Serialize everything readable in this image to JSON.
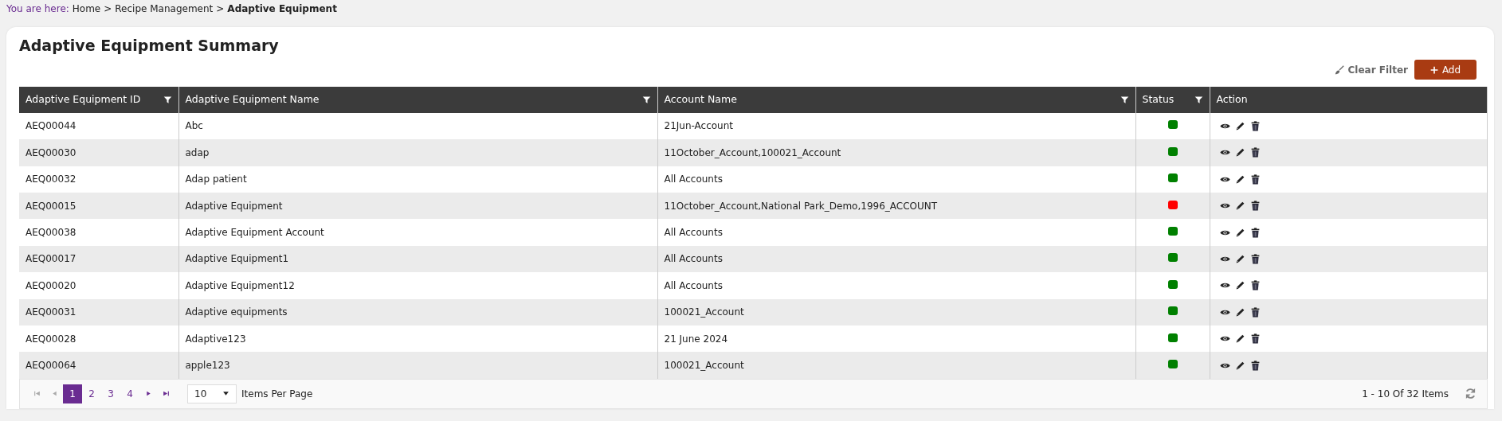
{
  "breadcrumb": {
    "prefix": "You are here:",
    "items": [
      {
        "label": "Home",
        "current": false
      },
      {
        "label": "Recipe Management",
        "current": false
      },
      {
        "label": "Adaptive Equipment",
        "current": true
      }
    ],
    "separator": ">"
  },
  "title": "Adaptive Equipment Summary",
  "toolbar": {
    "clear_filter": "Clear Filter",
    "add": "Add"
  },
  "table": {
    "columns": [
      {
        "label": "Adaptive Equipment ID",
        "filter": true
      },
      {
        "label": "Adaptive Equipment Name",
        "filter": true
      },
      {
        "label": "Account Name",
        "filter": true
      },
      {
        "label": "Status",
        "filter": true
      },
      {
        "label": "Action",
        "filter": false
      }
    ],
    "rows": [
      {
        "id": "AEQ00044",
        "name": "Abc",
        "account": "21Jun-Account",
        "color": "#008000"
      },
      {
        "id": "AEQ00030",
        "name": "adap",
        "account": "11October_Account,100021_Account",
        "color": "#008000"
      },
      {
        "id": "AEQ00032",
        "name": "Adap patient",
        "account": "All Accounts",
        "color": "#008000"
      },
      {
        "id": "AEQ00015",
        "name": "Adaptive Equipment",
        "account": "11October_Account,National Park_Demo,1996_ACCOUNT",
        "color": "#ff0000"
      },
      {
        "id": "AEQ00038",
        "name": "Adaptive Equipment Account",
        "account": "All Accounts",
        "color": "#008000"
      },
      {
        "id": "AEQ00017",
        "name": "Adaptive Equipment1",
        "account": "All Accounts",
        "color": "#008000"
      },
      {
        "id": "AEQ00020",
        "name": "Adaptive Equipment12",
        "account": "All Accounts",
        "color": "#008000"
      },
      {
        "id": "AEQ00031",
        "name": "Adaptive equipments",
        "account": "100021_Account",
        "color": "#008000"
      },
      {
        "id": "AEQ00028",
        "name": "Adaptive123",
        "account": "21 June 2024",
        "color": "#008000"
      },
      {
        "id": "AEQ00064",
        "name": "apple123",
        "account": "100021_Account",
        "color": "#008000"
      }
    ]
  },
  "pager": {
    "pages": [
      {
        "label": "1",
        "selected": true
      },
      {
        "label": "2",
        "selected": false
      },
      {
        "label": "3",
        "selected": false
      },
      {
        "label": "4",
        "selected": false
      }
    ],
    "page_size": "10",
    "page_size_label": "Items Per Page",
    "summary": "1 - 10 Of 32 Items"
  }
}
